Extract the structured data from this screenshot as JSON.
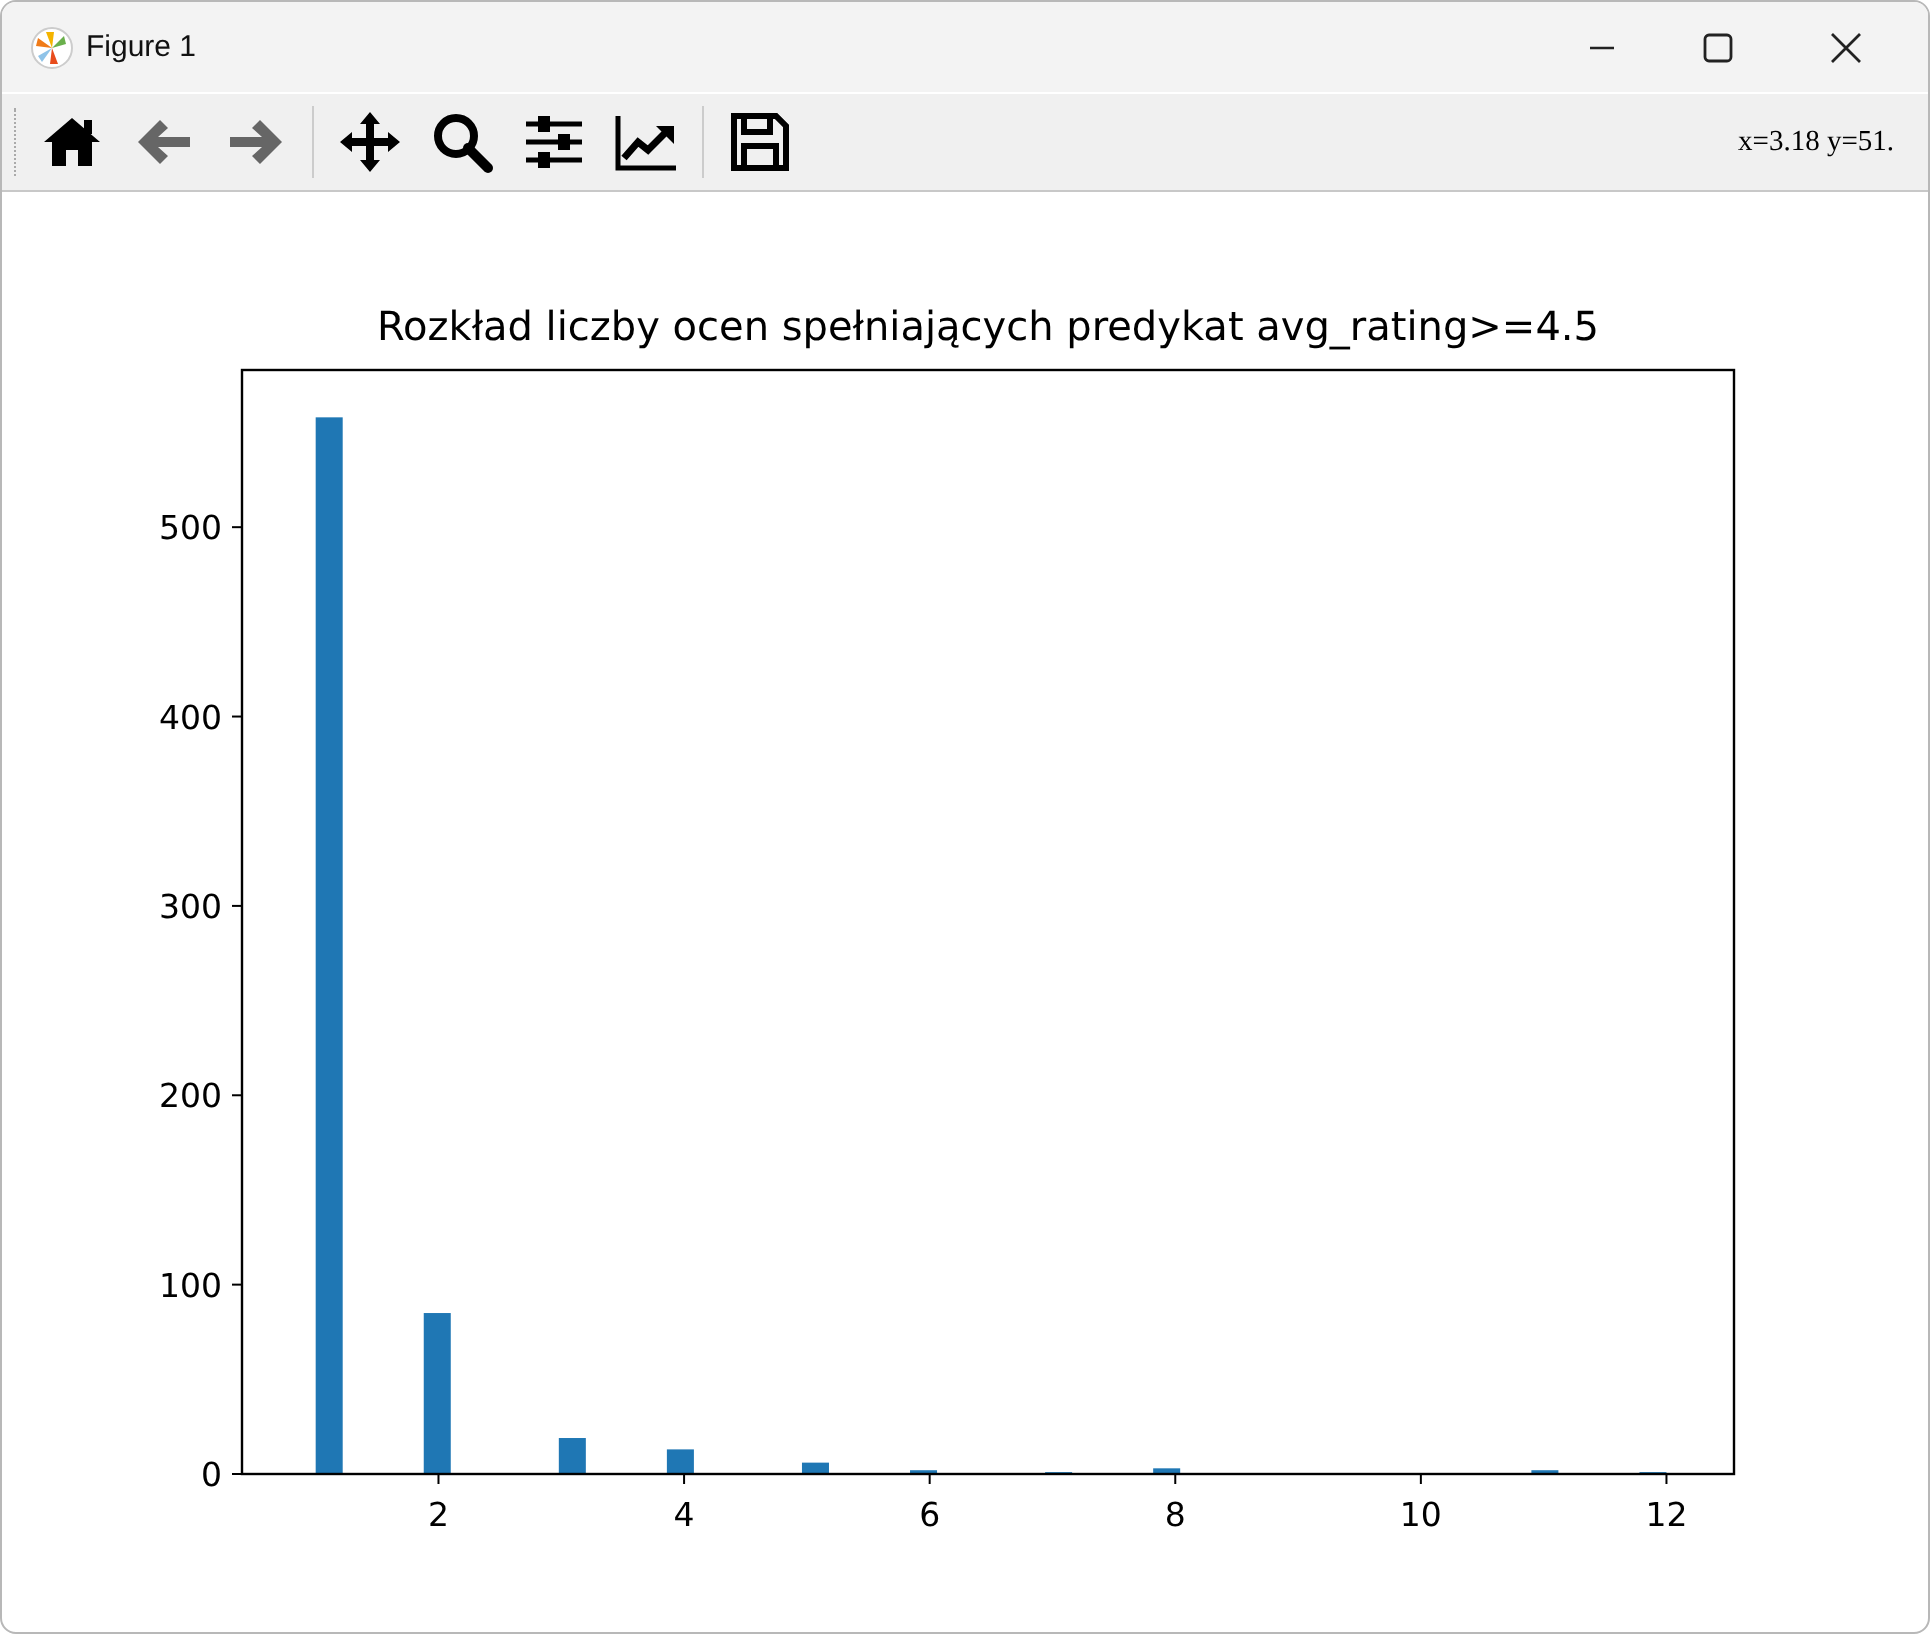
{
  "window": {
    "title": "Figure 1"
  },
  "toolbar": {
    "buttons": [
      {
        "kind": "home",
        "disabled": false
      },
      {
        "kind": "back",
        "disabled": true
      },
      {
        "kind": "forward",
        "disabled": true
      },
      {
        "kind": "pan",
        "disabled": false
      },
      {
        "kind": "zoom",
        "disabled": false
      },
      {
        "kind": "subplots",
        "disabled": false
      },
      {
        "kind": "axes",
        "disabled": false
      },
      {
        "kind": "save",
        "disabled": false
      }
    ],
    "coordinates": "x=3.18 y=51."
  },
  "figure": {
    "chart_data": {
      "type": "bar",
      "title": "Rozkład liczby ocen spełniających predykat avg_rating>=4.5",
      "x": [
        1.11,
        1.99,
        3.09,
        3.97,
        5.07,
        5.95,
        7.05,
        7.93,
        11.01,
        11.89
      ],
      "values": [
        558,
        85,
        19,
        13,
        6,
        2,
        1,
        3,
        2,
        1
      ],
      "xlim": [
        0.4,
        12.55
      ],
      "ylim": [
        0,
        583
      ],
      "xticks": [
        2,
        4,
        6,
        8,
        10,
        12
      ],
      "yticks": [
        0,
        100,
        200,
        300,
        400,
        500
      ]
    }
  }
}
